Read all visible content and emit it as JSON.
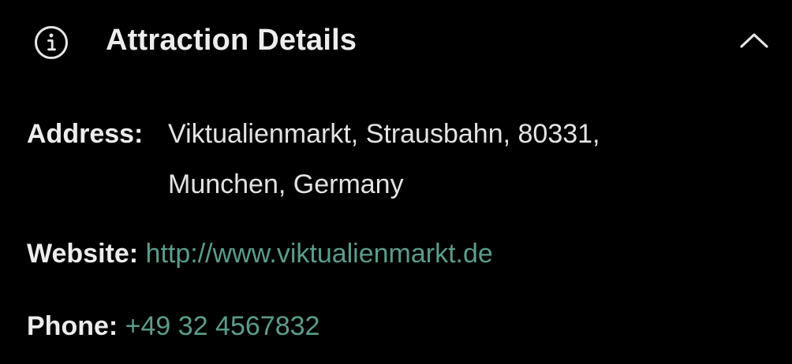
{
  "header": {
    "icon": "info-icon",
    "title": "Attraction Details",
    "toggle_icon": "chevron-up-icon"
  },
  "details": {
    "address_label": "Address:",
    "address_line1": "Viktualienmarkt, Strausbahn, 80331,",
    "address_line2": "Munchen, Germany",
    "website_label": "Website:",
    "website_url": "http://www.viktualienmarkt.de",
    "phone_label": "Phone:",
    "phone_number": "+49 32 4567832"
  },
  "colors": {
    "background": "#000000",
    "text": "#e9e9e9",
    "link": "#5c9c8a"
  }
}
